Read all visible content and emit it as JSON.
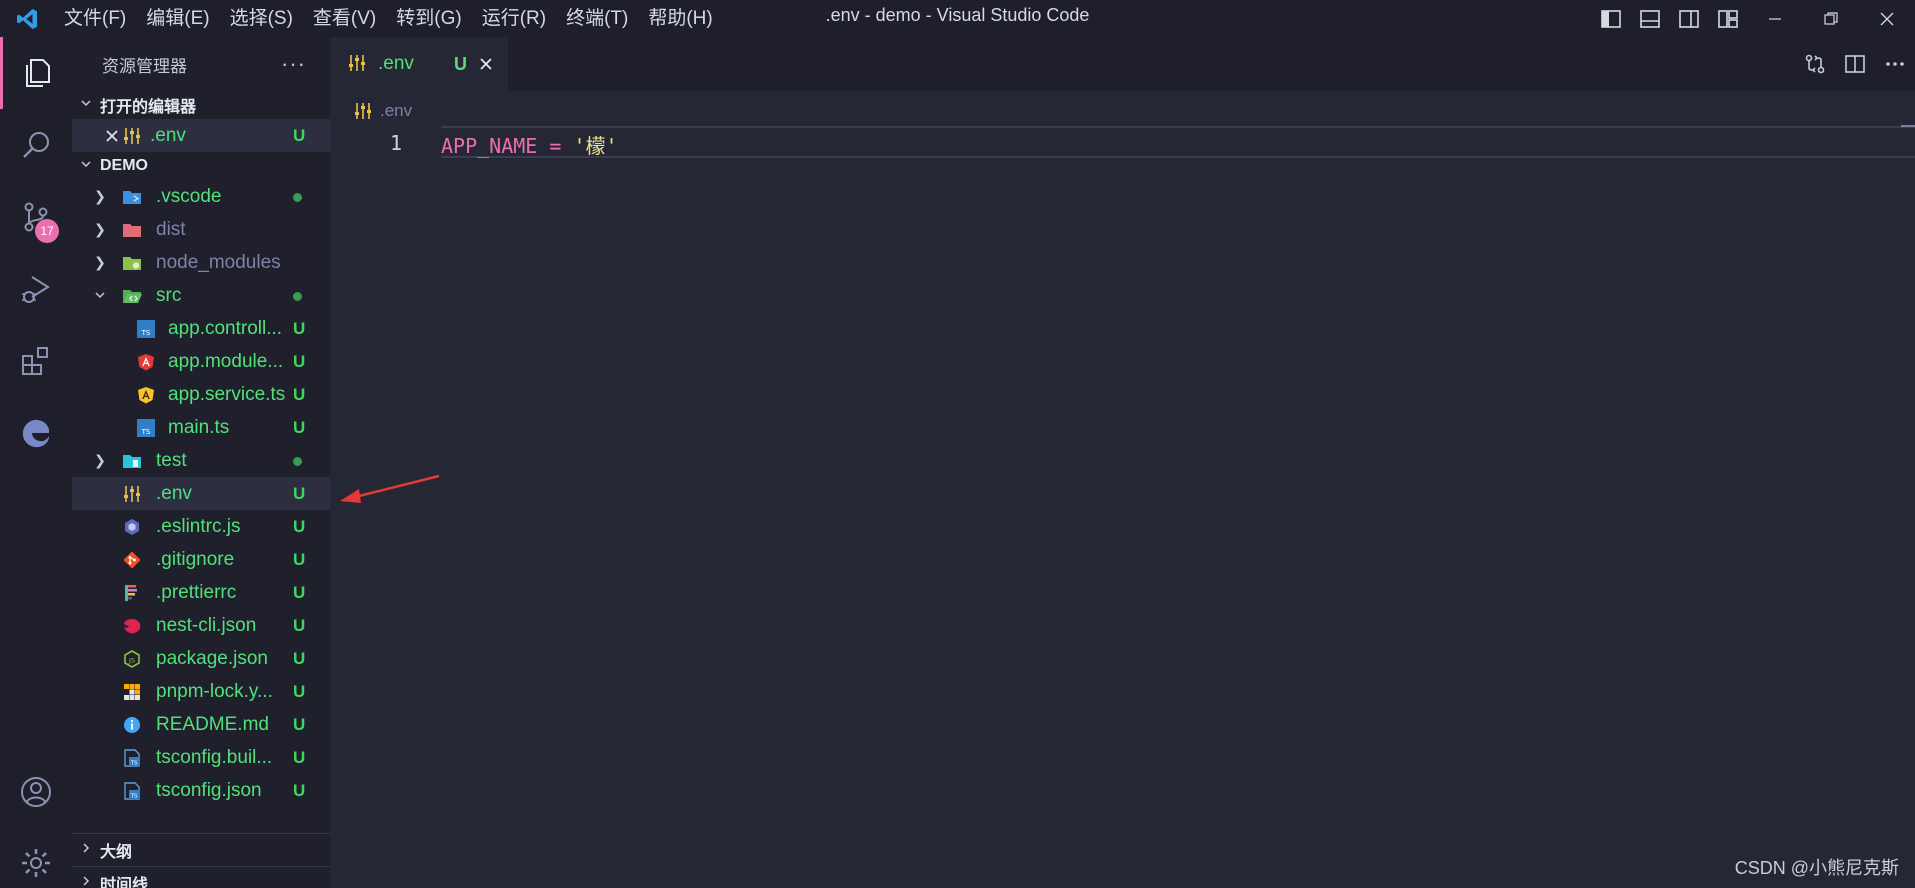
{
  "window": {
    "title": ".env - demo - Visual Studio Code"
  },
  "menu": [
    "文件(F)",
    "编辑(E)",
    "选择(S)",
    "查看(V)",
    "转到(G)",
    "运行(R)",
    "终端(T)",
    "帮助(H)"
  ],
  "activity": {
    "source_control_badge": "17"
  },
  "sidebar": {
    "title": "资源管理器",
    "more": "···",
    "open_editors": {
      "label": "打开的编辑器",
      "items": [
        {
          "name": ".env",
          "status": "U"
        }
      ]
    },
    "workspace": {
      "label": "DEMO",
      "items": [
        {
          "name": ".vscode",
          "status": "dot"
        },
        {
          "name": "dist",
          "status": ""
        },
        {
          "name": "node_modules",
          "status": ""
        },
        {
          "name": "src",
          "status": "dot"
        },
        {
          "name": "app.controll...",
          "status": "U"
        },
        {
          "name": "app.module...",
          "status": "U"
        },
        {
          "name": "app.service.ts",
          "status": "U"
        },
        {
          "name": "main.ts",
          "status": "U"
        },
        {
          "name": "test",
          "status": "dot"
        },
        {
          "name": ".env",
          "status": "U"
        },
        {
          "name": ".eslintrc.js",
          "status": "U"
        },
        {
          "name": ".gitignore",
          "status": "U"
        },
        {
          "name": ".prettierrc",
          "status": "U"
        },
        {
          "name": "nest-cli.json",
          "status": "U"
        },
        {
          "name": "package.json",
          "status": "U"
        },
        {
          "name": "pnpm-lock.y...",
          "status": "U"
        },
        {
          "name": "README.md",
          "status": "U"
        },
        {
          "name": "tsconfig.buil...",
          "status": "U"
        },
        {
          "name": "tsconfig.json",
          "status": "U"
        }
      ]
    },
    "outline": {
      "label": "大纲"
    },
    "timeline": {
      "label": "时间线"
    }
  },
  "editor": {
    "tab": {
      "name": ".env",
      "status": "U"
    },
    "breadcrumb": ".env",
    "lines": [
      {
        "number": "1",
        "var": "APP_NAME",
        "op": " = ",
        "value": "'檬'"
      }
    ]
  },
  "watermark": "CSDN @小熊尼克斯",
  "colors": {
    "accent": "#ea6fb0",
    "untracked": "#52e07a",
    "ignored": "#7d82a8",
    "string": "#e8e08a"
  }
}
